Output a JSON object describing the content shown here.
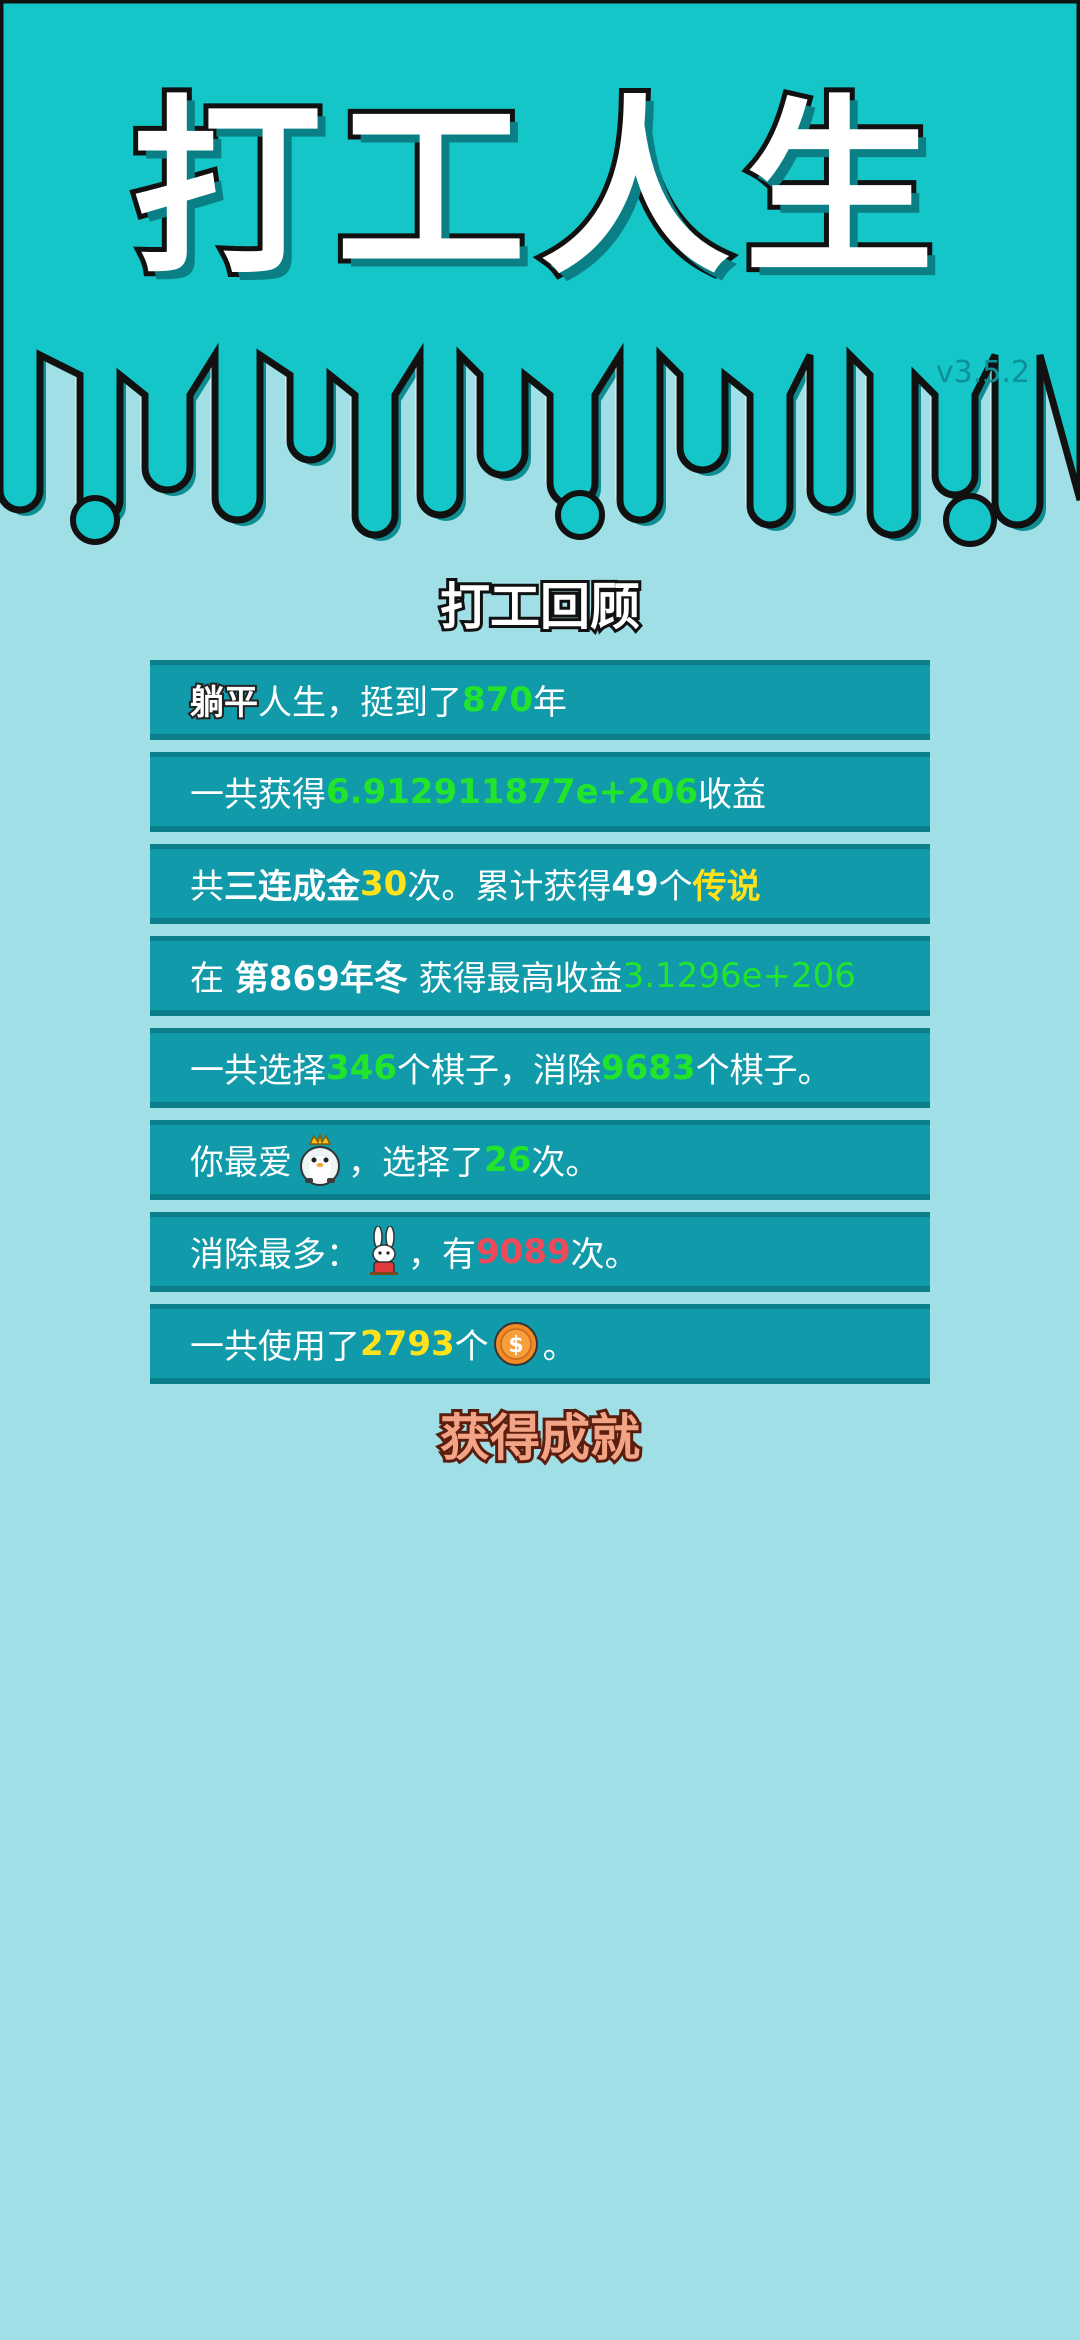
{
  "header": {
    "title": "打工人生",
    "version": "v3.5.2"
  },
  "review": {
    "title": "打工回顾",
    "rows": [
      {
        "parts": [
          "躺平",
          "人生，挺到了",
          "870",
          "年"
        ]
      },
      {
        "parts": [
          "一共获得",
          "6.912911877e+206",
          "收益"
        ]
      },
      {
        "parts": [
          "共",
          "三连成金",
          "30",
          "次。累计获得",
          "49",
          "个",
          "传说"
        ]
      },
      {
        "parts": [
          "在 ",
          "第869年冬",
          " 获得最高收益",
          "3.1296e+206"
        ]
      },
      {
        "parts": [
          "一共选择",
          "346",
          "个棋子，消除",
          "9683",
          "个棋子。"
        ]
      },
      {
        "parts": [
          "你最爱",
          "，选择了",
          "26",
          "次。"
        ],
        "icon": "penguin-king-icon"
      },
      {
        "parts": [
          "消除最多：",
          "，有",
          "9089",
          "次。"
        ],
        "icon": "rabbit-icon"
      },
      {
        "parts": [
          "一共使用了",
          "2793",
          "个",
          "。"
        ],
        "icon": "coin-icon"
      }
    ]
  },
  "achievements": {
    "title": "获得成就"
  },
  "colors": {
    "header_bg": "#14c6c8",
    "body_bg": "#a0dfe6",
    "row_bg": "#109aaa",
    "highlight_green": "#22e52b",
    "highlight_yellow": "#ffe21a",
    "highlight_red": "#f04a5a"
  }
}
